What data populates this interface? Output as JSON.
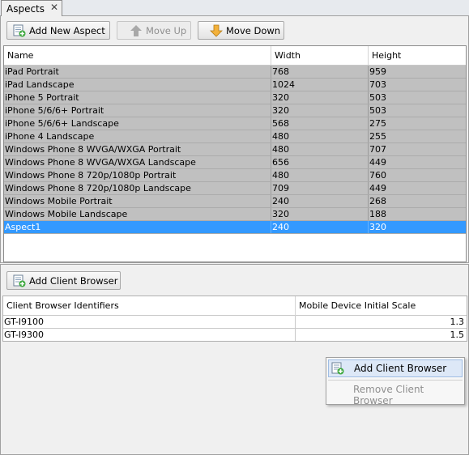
{
  "tab": {
    "title": "Aspects",
    "close_glyph": "✕"
  },
  "toolbar": {
    "add_new_aspect": "Add New Aspect",
    "move_up": "Move Up",
    "move_down": "Move Down"
  },
  "aspects_table": {
    "columns": [
      "Name",
      "Width",
      "Height"
    ],
    "rows": [
      {
        "name": "iPad Portrait",
        "width": "768",
        "height": "959"
      },
      {
        "name": "iPad Landscape",
        "width": "1024",
        "height": "703"
      },
      {
        "name": "iPhone 5 Portrait",
        "width": "320",
        "height": "503"
      },
      {
        "name": "iPhone 5/6/6+ Portrait",
        "width": "320",
        "height": "503"
      },
      {
        "name": "iPhone 5/6/6+ Landscape",
        "width": "568",
        "height": "275"
      },
      {
        "name": "iPhone 4 Landscape",
        "width": "480",
        "height": "255"
      },
      {
        "name": "Windows Phone 8 WVGA/WXGA Portrait",
        "width": "480",
        "height": "707"
      },
      {
        "name": "Windows Phone 8 WVGA/WXGA Landscape",
        "width": "656",
        "height": "449"
      },
      {
        "name": "Windows Phone 8 720p/1080p Portrait",
        "width": "480",
        "height": "760"
      },
      {
        "name": "Windows Phone 8 720p/1080p Landscape",
        "width": "709",
        "height": "449"
      },
      {
        "name": "Windows Mobile Portrait",
        "width": "240",
        "height": "268"
      },
      {
        "name": "Windows Mobile Landscape",
        "width": "320",
        "height": "188"
      },
      {
        "name": "Aspect1",
        "width": "240",
        "height": "320"
      }
    ],
    "selected_index": 12
  },
  "client_browser": {
    "add_button": "Add Client Browser",
    "columns": [
      "Client Browser Identifiers",
      "Mobile Device Initial Scale"
    ],
    "rows": [
      {
        "id": "GT-I9100",
        "scale": "1.3"
      },
      {
        "id": "GT-I9300",
        "scale": "1.5"
      }
    ]
  },
  "context_menu": {
    "add": "Add Client Browser",
    "remove": "Remove Client Browser"
  },
  "colors": {
    "selection": "#3399ff",
    "row_background": "#c0c0c0",
    "menu_hover": "#dde8f7"
  },
  "icons": {
    "add_aspect": "add-document-icon",
    "move_up": "arrow-up-icon",
    "move_down": "arrow-down-icon",
    "add_client_browser": "add-document-icon"
  }
}
